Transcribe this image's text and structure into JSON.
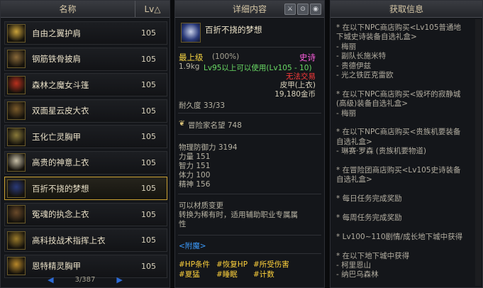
{
  "list": {
    "header": {
      "name": "名称",
      "lv": "Lv△"
    },
    "items": [
      {
        "name": "自由之翼护肩",
        "level": "105"
      },
      {
        "name": "钢筋铁骨披肩",
        "level": "105"
      },
      {
        "name": "森林之魔女斗篷",
        "level": "105"
      },
      {
        "name": "双面星云皮大衣",
        "level": "105"
      },
      {
        "name": "玉化亡灵胸甲",
        "level": "105"
      },
      {
        "name": "高贵的神意上衣",
        "level": "105"
      },
      {
        "name": "百折不挠的梦想",
        "level": "105"
      },
      {
        "name": "冤魂的执念上衣",
        "level": "105"
      },
      {
        "name": "高科技战术指挥上衣",
        "level": "105"
      },
      {
        "name": "恩特精灵胸甲",
        "level": "105"
      }
    ],
    "page": "3/387",
    "colors": {
      "item_text": "#e8dfc6",
      "selected_border": "#c9a033"
    }
  },
  "detail": {
    "header": "详细内容",
    "item_name": "百折不挠的梦想",
    "grade_label": "最上级",
    "grade_pct": "(100%)",
    "rarity": "史诗",
    "weight": "1.9kg",
    "level_req": "Lv95以上可以使用(Lv105 - 10)",
    "trade": "无法交易",
    "type": "皮甲(上衣)",
    "price": "19,180金币",
    "durability": "耐久度 33/33",
    "fame": "冒险家名望 748",
    "stats": [
      "物理防御力 3194",
      "力量 151",
      "智力 151",
      "体力 100",
      "精神 156"
    ],
    "effects": [
      "可以材质变更",
      "转换为稀有时，适用辅助职业专属属",
      "性"
    ],
    "enchant": "<附魔>",
    "tags": [
      [
        "#HP条件",
        "#恢复HP",
        "#所受伤害"
      ],
      [
        "#夏猛",
        "#睡眠",
        "#计数"
      ]
    ],
    "colors": {
      "rarity": "#ff5ee0",
      "grade": "#f6d443",
      "trade": "#ff3b3b",
      "tag": "#ffd23c"
    }
  },
  "obtain": {
    "header": "获取信息",
    "lines": [
      "* 在以下NPC商店购买<Lv105普通地",
      "下城史诗装备自选礼盒>",
      "- 梅丽",
      "- 副队长施米特",
      "- 贵德伊兹",
      "- 光之铁匠克雷欧",
      "",
      "* 在以下NPC商店购买<毁坏的寂静城",
      "(高级)装备自选礼盒>",
      "- 梅丽",
      "",
      "* 在以下NPC商店购买<贵族机要装备",
      "自选礼盒>",
      "- 琳赛·罗森 (贵族机要物道)",
      "",
      "* 在冒险团商店购买<Lv105史诗装备",
      "自选礼盒>",
      "",
      "* 每日任务完成奖励",
      "",
      "* 每周任务完成奖励",
      "",
      "* Lv100~110剧情/成长地下城中获得",
      "",
      "* 在以下地下城中获得",
      "- 柯里恩山",
      "- 纳巴乌森林"
    ]
  }
}
